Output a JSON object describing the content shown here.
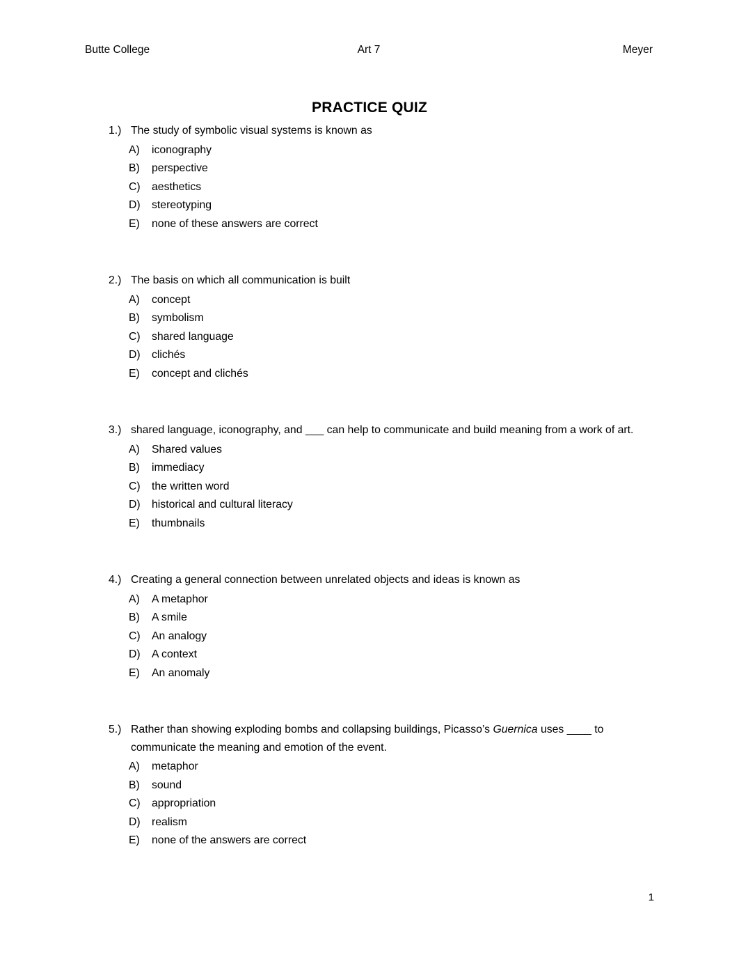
{
  "header": {
    "left": "Butte College",
    "center": "Art 7",
    "right": "Meyer"
  },
  "title": "PRACTICE QUIZ",
  "footer": {
    "page_number": "1"
  },
  "questions": [
    {
      "number": "1.)",
      "text": "The study of symbolic visual systems is known as",
      "options": [
        {
          "letter": "A)",
          "text": "iconography"
        },
        {
          "letter": "B)",
          "text": "perspective"
        },
        {
          "letter": "C)",
          "text": "aesthetics"
        },
        {
          "letter": "D)",
          "text": "stereotyping"
        },
        {
          "letter": "E)",
          "text": "none of these answers are correct"
        }
      ]
    },
    {
      "number": "2.)",
      "text": "The basis on which all communication is built",
      "options": [
        {
          "letter": "A)",
          "text": "concept"
        },
        {
          "letter": "B)",
          "text": "symbolism"
        },
        {
          "letter": "C)",
          "text": "shared language"
        },
        {
          "letter": "D)",
          "text": "clichés"
        },
        {
          "letter": "E)",
          "text": "concept and clichés"
        }
      ]
    },
    {
      "number": "3.)",
      "text": "shared language, iconography, and ___ can help to communicate and build meaning from a work of art.",
      "options": [
        {
          "letter": "A)",
          "text": "Shared values"
        },
        {
          "letter": "B)",
          "text": "immediacy"
        },
        {
          "letter": "C)",
          "text": "the written word"
        },
        {
          "letter": "D)",
          "text": "historical and cultural literacy"
        },
        {
          "letter": "E)",
          "text": "thumbnails"
        }
      ]
    },
    {
      "number": "4.)",
      "text": "Creating a general connection between unrelated objects and ideas is known as",
      "options": [
        {
          "letter": "A)",
          "text": "A metaphor"
        },
        {
          "letter": "B)",
          "text": "A smile"
        },
        {
          "letter": "C)",
          "text": "An analogy"
        },
        {
          "letter": "D)",
          "text": "A context"
        },
        {
          "letter": "E)",
          "text": "An anomaly"
        }
      ]
    },
    {
      "number": "5.)",
      "text_parts": [
        {
          "text": "Rather than showing exploding bombs and collapsing buildings, Picasso’s ",
          "italic": false
        },
        {
          "text": "Guernica",
          "italic": true
        },
        {
          "text": " uses ____ to communicate the meaning and emotion of the event.",
          "italic": false
        }
      ],
      "options": [
        {
          "letter": "A)",
          "text": "metaphor"
        },
        {
          "letter": "B)",
          "text": "sound"
        },
        {
          "letter": "C)",
          "text": "appropriation"
        },
        {
          "letter": "D)",
          "text": "realism"
        },
        {
          "letter": "E)",
          "text": "none of the answers are correct"
        }
      ]
    }
  ]
}
